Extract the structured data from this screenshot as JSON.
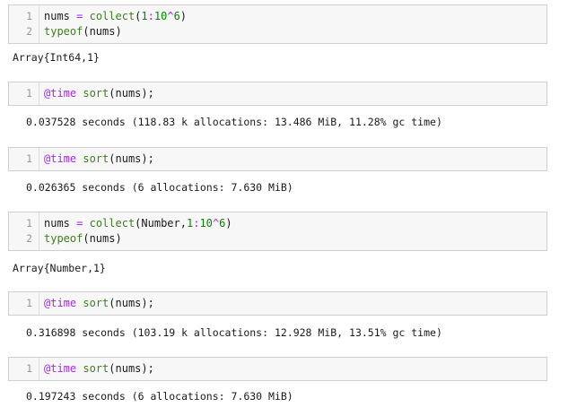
{
  "colors": {
    "cell_background": "#f7f7f7",
    "cell_border": "#cfcfcf",
    "line_number": "#999999",
    "text": "#1a1a1a",
    "builtin": "#3d7f1f",
    "macro": "#aa22ff",
    "operator": "#aa22ff",
    "number": "#008800"
  },
  "cells": [
    {
      "lines": [
        {
          "num": "1",
          "tokens": [
            {
              "t": "nums ",
              "c": "text"
            },
            {
              "t": "=",
              "c": "operator"
            },
            {
              "t": " ",
              "c": "text"
            },
            {
              "t": "collect",
              "c": "builtin"
            },
            {
              "t": "(",
              "c": "text"
            },
            {
              "t": "1",
              "c": "number"
            },
            {
              "t": ":",
              "c": "operator"
            },
            {
              "t": "10",
              "c": "number"
            },
            {
              "t": "^",
              "c": "operator"
            },
            {
              "t": "6",
              "c": "number"
            },
            {
              "t": ")",
              "c": "text"
            }
          ]
        },
        {
          "num": "2",
          "tokens": [
            {
              "t": "typeof",
              "c": "builtin"
            },
            {
              "t": "(nums)",
              "c": "text"
            }
          ]
        }
      ],
      "output": "Array{Int64,1}"
    },
    {
      "lines": [
        {
          "num": "1",
          "tokens": [
            {
              "t": "@time",
              "c": "macro"
            },
            {
              "t": " ",
              "c": "text"
            },
            {
              "t": "sort",
              "c": "builtin"
            },
            {
              "t": "(nums);",
              "c": "text"
            }
          ]
        }
      ],
      "output": "0.037528 seconds (118.83 k allocations: 13.486 MiB, 11.28% gc time)"
    },
    {
      "lines": [
        {
          "num": "1",
          "tokens": [
            {
              "t": "@time",
              "c": "macro"
            },
            {
              "t": " ",
              "c": "text"
            },
            {
              "t": "sort",
              "c": "builtin"
            },
            {
              "t": "(nums);",
              "c": "text"
            }
          ]
        }
      ],
      "output": "0.026365 seconds (6 allocations: 7.630 MiB)"
    },
    {
      "lines": [
        {
          "num": "1",
          "tokens": [
            {
              "t": "nums ",
              "c": "text"
            },
            {
              "t": "=",
              "c": "operator"
            },
            {
              "t": " ",
              "c": "text"
            },
            {
              "t": "collect",
              "c": "builtin"
            },
            {
              "t": "(Number,",
              "c": "text"
            },
            {
              "t": "1",
              "c": "number"
            },
            {
              "t": ":",
              "c": "operator"
            },
            {
              "t": "10",
              "c": "number"
            },
            {
              "t": "^",
              "c": "operator"
            },
            {
              "t": "6",
              "c": "number"
            },
            {
              "t": ")",
              "c": "text"
            }
          ]
        },
        {
          "num": "2",
          "tokens": [
            {
              "t": "typeof",
              "c": "builtin"
            },
            {
              "t": "(nums)",
              "c": "text"
            }
          ]
        }
      ],
      "output": "Array{Number,1}"
    },
    {
      "lines": [
        {
          "num": "1",
          "tokens": [
            {
              "t": "@time",
              "c": "macro"
            },
            {
              "t": " ",
              "c": "text"
            },
            {
              "t": "sort",
              "c": "builtin"
            },
            {
              "t": "(nums);",
              "c": "text"
            }
          ]
        }
      ],
      "output": "0.316898 seconds (103.19 k allocations: 12.928 MiB, 13.51% gc time)"
    },
    {
      "lines": [
        {
          "num": "1",
          "tokens": [
            {
              "t": "@time",
              "c": "macro"
            },
            {
              "t": " ",
              "c": "text"
            },
            {
              "t": "sort",
              "c": "builtin"
            },
            {
              "t": "(nums);",
              "c": "text"
            }
          ]
        }
      ],
      "output": "0.197243 seconds (6 allocations: 7.630 MiB)"
    }
  ]
}
